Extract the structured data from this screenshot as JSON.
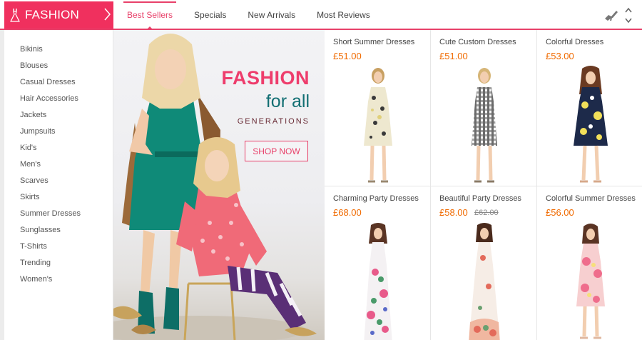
{
  "brand": {
    "label": "FASHION",
    "color": "#f0305e"
  },
  "tabs": [
    {
      "label": "Best Sellers",
      "active": true
    },
    {
      "label": "Specials"
    },
    {
      "label": "New Arrivals"
    },
    {
      "label": "Most Reviews"
    }
  ],
  "controls": {
    "icons": [
      "shoe-icon",
      "chevron-up-icon",
      "chevron-down-icon"
    ]
  },
  "categories": [
    "Bikinis",
    "Blouses",
    "Casual Dresses",
    "Hair Accessories",
    "Jackets",
    "Jumpsuits",
    "Kid's",
    "Men's",
    "Scarves",
    "Skirts",
    "Summer Dresses",
    "Sunglasses",
    "T-Shirts",
    "Trending",
    "Women's"
  ],
  "banner": {
    "title": "FASHION",
    "subtitle": "for all",
    "tagline": "GENERATIONS",
    "button_label": "SHOP NOW"
  },
  "products": [
    {
      "name": "Short Summer Dresses",
      "price": "£51.00",
      "old_price": "",
      "dress": "floral-cream"
    },
    {
      "name": "Cute Custom Dresses",
      "price": "£51.00",
      "old_price": "",
      "dress": "gingham"
    },
    {
      "name": "Colorful Dresses",
      "price": "£53.00",
      "old_price": "",
      "dress": "navy-floral"
    },
    {
      "name": "Charming Party Dresses",
      "price": "£68.00",
      "old_price": "",
      "dress": "maxi-floral"
    },
    {
      "name": "Beautiful Party Dresses",
      "price": "£58.00",
      "old_price": "£62.00",
      "dress": "halter-floral"
    },
    {
      "name": "Colorful Summer Dresses",
      "price": "£56.00",
      "old_price": "",
      "dress": "pink-floral"
    }
  ],
  "colors": {
    "accent": "#e8416a",
    "price": "#f06a00",
    "banner_title": "#ee3d6c",
    "banner_sub": "#116e72"
  }
}
